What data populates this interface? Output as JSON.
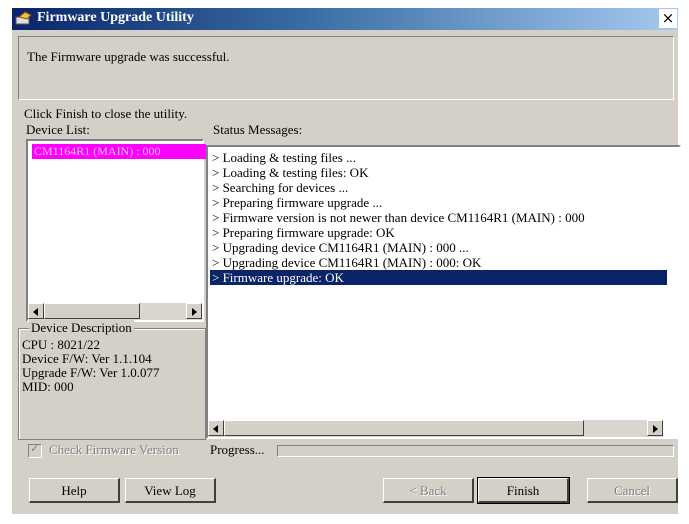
{
  "window": {
    "title": "Firmware Upgrade Utility",
    "close_glyph": "×"
  },
  "message": {
    "result": "The Firmware upgrade was successful.",
    "hint": "Click Finish to close the utility."
  },
  "device_list": {
    "label": "Device List:",
    "items": [
      "CM1164R1 (MAIN) : 000"
    ]
  },
  "device_description": {
    "title": "Device Description",
    "lines": [
      "CPU : 8021/22",
      "Device F/W: Ver 1.1.104",
      "Upgrade F/W: Ver 1.0.077",
      "MID: 000"
    ]
  },
  "status": {
    "label": "Status Messages:",
    "lines": [
      "> Loading & testing files ...",
      "> Loading & testing files: OK",
      "> Searching for devices ...",
      "> Preparing firmware upgrade ...",
      "> Firmware version is not newer than device CM1164R1 (MAIN) : 000",
      "> Preparing firmware upgrade: OK",
      "> Upgrading device CM1164R1 (MAIN) : 000 ...",
      "> Upgrading device CM1164R1 (MAIN) : 000: OK",
      "> Firmware upgrade: OK"
    ],
    "selected_index": 8
  },
  "check_firmware": {
    "label": "Check Firmware Version",
    "checked": true,
    "check_glyph": "✓"
  },
  "progress": {
    "label": "Progress...",
    "value": 0
  },
  "buttons": {
    "help": "Help",
    "view_log": "View Log",
    "back": "< Back",
    "finish": "Finish",
    "cancel": "Cancel"
  },
  "colors": {
    "title_gradient_start": "#0a246a",
    "selected_device": "#ff00ff",
    "selected_status": "#0a246a"
  }
}
